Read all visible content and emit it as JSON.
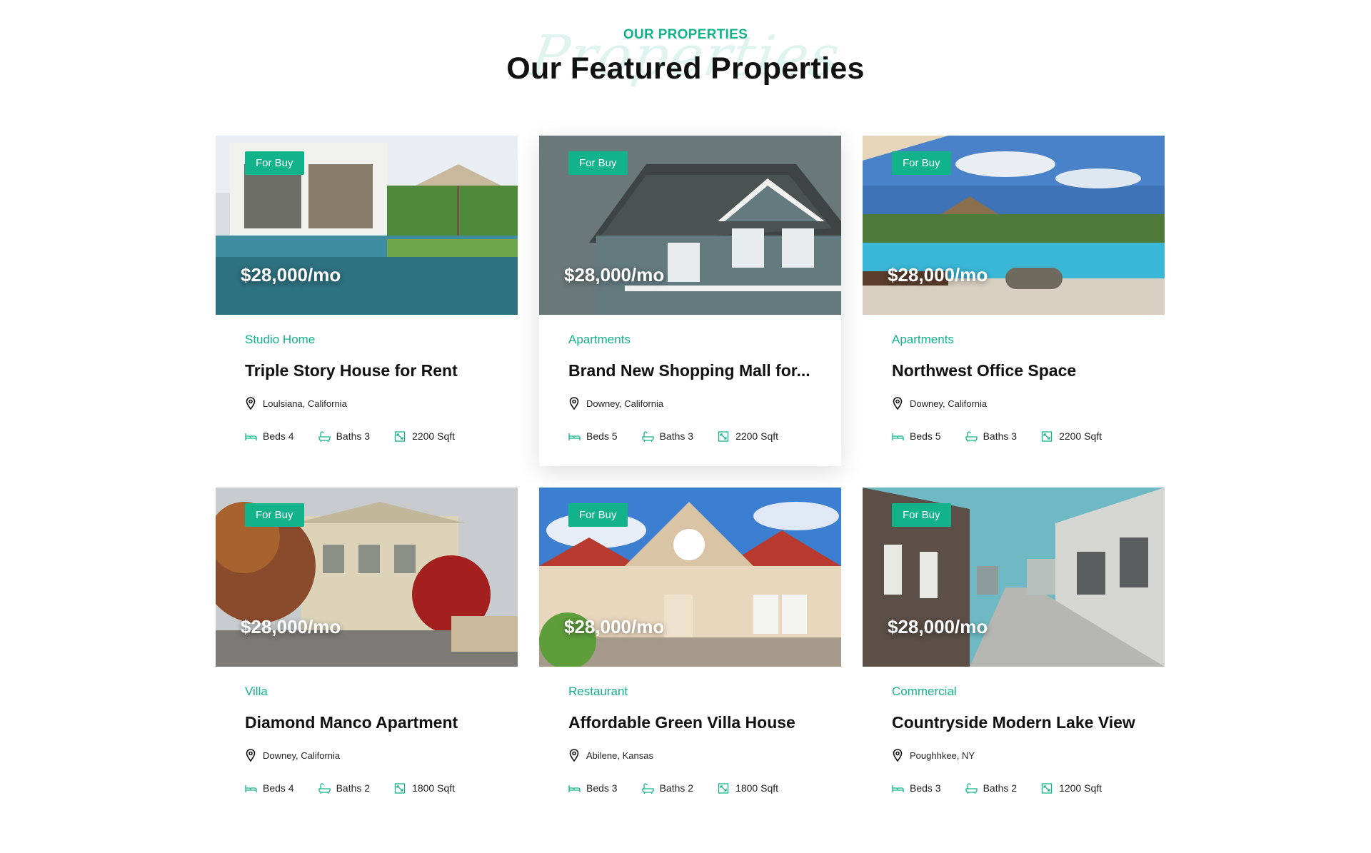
{
  "header": {
    "eyebrow": "OUR PROPERTIES",
    "script_bg": "Properties",
    "title": "Our Featured Properties"
  },
  "colors": {
    "accent": "#12b38a",
    "text": "#111111"
  },
  "icons": {
    "location": "map-pin-icon",
    "beds": "bed-icon",
    "baths": "bath-icon",
    "area": "area-icon"
  },
  "properties": [
    {
      "badge": "For Buy",
      "price": "$28,000/mo",
      "category": "Studio Home",
      "name": "Triple Story House for Rent",
      "location": "Loulsiana, California",
      "beds": "Beds 4",
      "baths": "Baths 3",
      "area": "2200 Sqft"
    },
    {
      "badge": "For Buy",
      "price": "$28,000/mo",
      "category": "Apartments",
      "name": "Brand New Shopping Mall for...",
      "location": "Downey, California",
      "beds": "Beds 5",
      "baths": "Baths 3",
      "area": "2200 Sqft"
    },
    {
      "badge": "For Buy",
      "price": "$28,000/mo",
      "category": "Apartments",
      "name": "Northwest Office Space",
      "location": "Downey, California",
      "beds": "Beds 5",
      "baths": "Baths 3",
      "area": "2200 Sqft"
    },
    {
      "badge": "For Buy",
      "price": "$28,000/mo",
      "category": "Villa",
      "name": "Diamond Manco Apartment",
      "location": "Downey, California",
      "beds": "Beds 4",
      "baths": "Baths 2",
      "area": "1800 Sqft"
    },
    {
      "badge": "For Buy",
      "price": "$28,000/mo",
      "category": "Restaurant",
      "name": "Affordable Green Villa House",
      "location": "Abilene, Kansas",
      "beds": "Beds 3",
      "baths": "Baths 2",
      "area": "1800 Sqft"
    },
    {
      "badge": "For Buy",
      "price": "$28,000/mo",
      "category": "Commercial",
      "name": "Countryside Modern Lake View",
      "location": "Poughhkee, NY",
      "beds": "Beds 3",
      "baths": "Baths 2",
      "area": "1200 Sqft"
    }
  ]
}
